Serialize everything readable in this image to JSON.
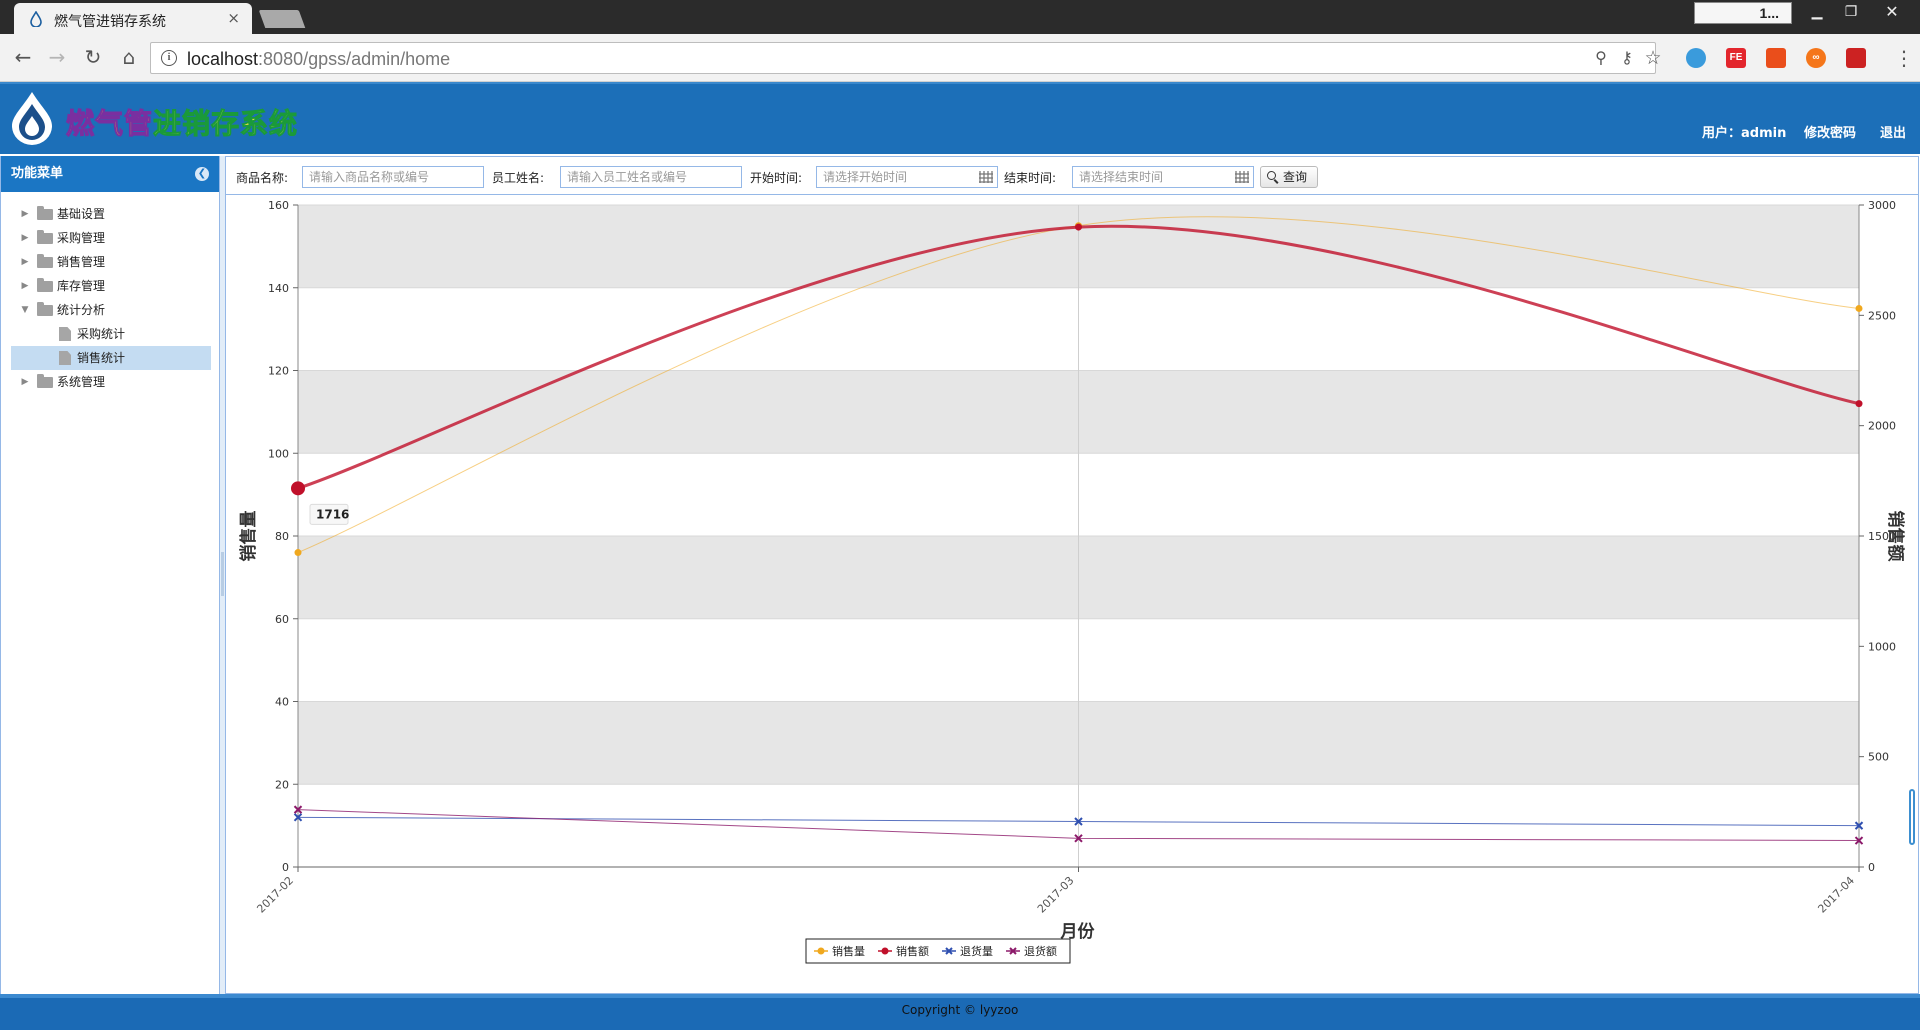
{
  "browser": {
    "tab_title": "燃气管进销存系统",
    "tab_close": "×",
    "user_badge": "1...",
    "url_host": "localhost",
    "url_rest": ":8080/gpss/admin/home",
    "extensions": [
      "",
      "FE",
      "",
      "∞",
      ""
    ]
  },
  "header": {
    "title_part1": "燃气管",
    "title_part2": "进销存系统",
    "user_label": "用户：admin",
    "change_password": "修改密码",
    "logout": "退出"
  },
  "sidebar": {
    "title": "功能菜单",
    "items": [
      {
        "label": "基础设置",
        "level": 0,
        "expanded": false
      },
      {
        "label": "采购管理",
        "level": 0,
        "expanded": false
      },
      {
        "label": "销售管理",
        "level": 0,
        "expanded": false
      },
      {
        "label": "库存管理",
        "level": 0,
        "expanded": false
      },
      {
        "label": "统计分析",
        "level": 0,
        "expanded": true
      },
      {
        "label": "采购统计",
        "level": 1
      },
      {
        "label": "销售统计",
        "level": 1,
        "selected": true
      },
      {
        "label": "系统管理",
        "level": 0,
        "expanded": false
      }
    ]
  },
  "filters": {
    "product_label": "商品名称:",
    "product_placeholder": "请输入商品名称或编号",
    "employee_label": "员工姓名:",
    "employee_placeholder": "请输入员工姓名或编号",
    "start_label": "开始时间:",
    "start_placeholder": "请选择开始时间",
    "end_label": "结束时间:",
    "end_placeholder": "请选择结束时间",
    "search_button": "查询"
  },
  "chart_data": {
    "type": "line",
    "categories": [
      "2017-02",
      "2017-03",
      "2017-04"
    ],
    "xlabel": "月份",
    "ylabel_left": "销售量",
    "ylabel_right": "销售额",
    "ylim_left": [
      0,
      160
    ],
    "yticks_left": [
      0,
      20,
      40,
      60,
      80,
      100,
      120,
      140,
      160
    ],
    "ylim_right": [
      0,
      3000
    ],
    "yticks_right": [
      0,
      500,
      1000,
      1500,
      2000,
      2500,
      3000
    ],
    "grid": true,
    "legend_position": "bottom-center",
    "tooltip": "1716",
    "series": [
      {
        "name": "销售量",
        "axis": "left",
        "color": "#f0a81e",
        "values": [
          76,
          155,
          135
        ],
        "marker": "circle",
        "smooth": true
      },
      {
        "name": "销售额",
        "axis": "right",
        "color": "#c0102a",
        "values": [
          1716,
          2900,
          2100
        ],
        "marker": "circle",
        "smooth": true
      },
      {
        "name": "退货量",
        "axis": "left",
        "color": "#2f4fb0",
        "values": [
          12,
          11,
          10
        ],
        "marker": "cross"
      },
      {
        "name": "退货额",
        "axis": "right",
        "color": "#8c1a6a",
        "values": [
          260,
          130,
          120
        ],
        "marker": "cross"
      }
    ]
  },
  "footer": {
    "copyright": "Copyright © lyyzoo"
  },
  "colors": {
    "header_blue": "#1c6fb8",
    "border_blue": "#95b8e7",
    "selected_bg": "#c4dcf2"
  }
}
